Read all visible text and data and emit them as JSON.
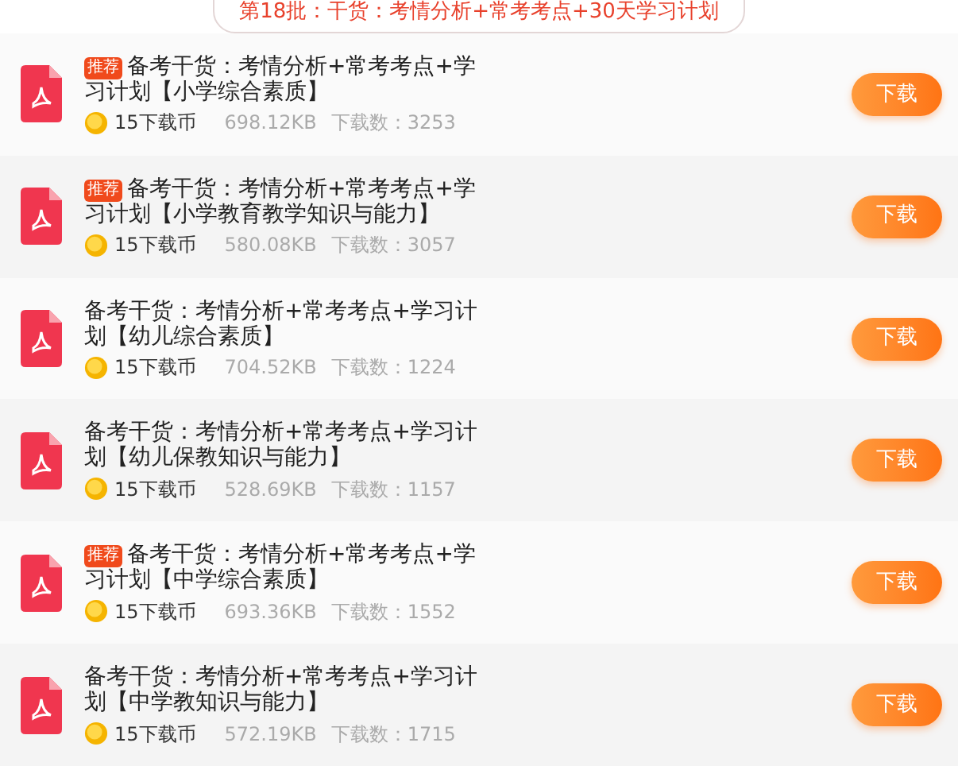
{
  "header": {
    "title": "第18批：干货：考情分析+常考考点+30天学习计划"
  },
  "files": [
    {
      "badge": "推荐",
      "title": "备考干货：考情分析+常考考点+学习计划【小学综合素质】",
      "coins": "15下载币",
      "size": "698.12KB",
      "downloads": "下载数：3253",
      "button": "下载"
    },
    {
      "badge": "推荐",
      "title": "备考干货：考情分析+常考考点+学习计划【小学教育教学知识与能力】",
      "coins": "15下载币",
      "size": "580.08KB",
      "downloads": "下载数：3057",
      "button": "下载"
    },
    {
      "title": "备考干货：考情分析+常考考点+学习计划【幼儿综合素质】",
      "coins": "15下载币",
      "size": "704.52KB",
      "downloads": "下载数：1224",
      "button": "下载"
    },
    {
      "title": "备考干货：考情分析+常考考点+学习计划【幼儿保教知识与能力】",
      "coins": "15下载币",
      "size": "528.69KB",
      "downloads": "下载数：1157",
      "button": "下载"
    },
    {
      "badge": "推荐",
      "title": "备考干货：考情分析+常考考点+学习计划【中学综合素质】",
      "coins": "15下载币",
      "size": "693.36KB",
      "downloads": "下载数：1552",
      "button": "下载"
    },
    {
      "title": "备考干货：考情分析+常考考点+学习计划【中学教知识与能力】",
      "coins": "15下载币",
      "size": "572.19KB",
      "downloads": "下载数：1715",
      "button": "下载"
    }
  ]
}
